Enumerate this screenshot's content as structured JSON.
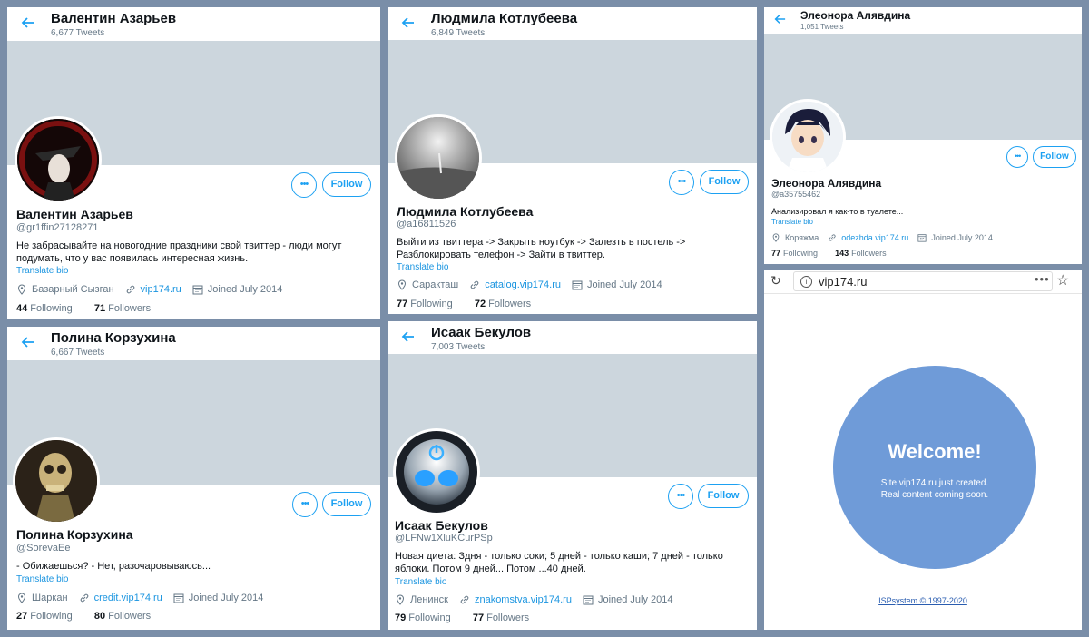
{
  "profiles": [
    {
      "name": "Валентин Азарьев",
      "tweets": "6,677 Tweets",
      "handle": "@gr1ffin27128271",
      "bio": "Не забрасывайте на новогодние праздники свой твиттер - люди могут подумать, что у вас появилась интересная жизнь.",
      "translate": "Translate bio",
      "location": "Базарный Сызган",
      "link": "vip174.ru",
      "joined": "Joined July 2014",
      "following_count": "44",
      "following_label": "Following",
      "followers_count": "71",
      "followers_label": "Followers",
      "follow_label": "Follow",
      "more_label": "•••"
    },
    {
      "name": "Людмила Котлубеева",
      "tweets": "6,849 Tweets",
      "handle": "@a16811526",
      "bio": "Выйти из твиттера -> Закрыть ноутбук -> Залезть в постель -> Разблокировать телефон -> Зайти в твиттер.",
      "translate": "Translate bio",
      "location": "Саракташ",
      "link": "catalog.vip174.ru",
      "joined": "Joined July 2014",
      "following_count": "77",
      "following_label": "Following",
      "followers_count": "72",
      "followers_label": "Followers",
      "follow_label": "Follow",
      "more_label": "•••"
    },
    {
      "name": "Элеонора Алявдина",
      "tweets": "1,051 Tweets",
      "handle": "@a35755462",
      "bio": "Анализировал я как-то в туалете...",
      "translate": "Translate bio",
      "location": "Коряжма",
      "link": "odezhda.vip174.ru",
      "joined": "Joined July 2014",
      "following_count": "77",
      "following_label": "Following",
      "followers_count": "143",
      "followers_label": "Followers",
      "follow_label": "Follow",
      "more_label": "•••"
    },
    {
      "name": "Полина Корзухина",
      "tweets": "6,667 Tweets",
      "handle": "@SorevaEe",
      "bio": "- Обижаешься? - Нет, разочаровываюсь...",
      "translate": "Translate bio",
      "location": "Шаркан",
      "link": "credit.vip174.ru",
      "joined": "Joined July 2014",
      "following_count": "27",
      "following_label": "Following",
      "followers_count": "80",
      "followers_label": "Followers",
      "follow_label": "Follow",
      "more_label": "•••"
    },
    {
      "name": "Исаак Бекулов",
      "tweets": "7,003 Tweets",
      "handle": "@LFNw1XluKCurPSp",
      "bio": "Новая диета: Здня - только соки; 5 дней - только каши; 7 дней - только яблоки. Потом 9 дней... Потом ...40 дней.",
      "translate": "Translate bio",
      "location": "Ленинск",
      "link": "znakomstva.vip174.ru",
      "joined": "Joined July 2014",
      "following_count": "79",
      "following_label": "Following",
      "followers_count": "77",
      "followers_label": "Followers",
      "follow_label": "Follow",
      "more_label": "•••"
    }
  ],
  "browser": {
    "url": "vip174.ru",
    "menu_dots": "•••",
    "welcome_title": "Welcome!",
    "welcome_line1": "Site vip174.ru just created.",
    "welcome_line2": "Real content coming soon.",
    "copyright": "ISPsystem © 1997-2020"
  },
  "colors": {
    "accent": "#1da1f2",
    "banner": "#ccd6dd",
    "welcome_circle": "#6f9bd8",
    "background": "#7a8ea8"
  }
}
